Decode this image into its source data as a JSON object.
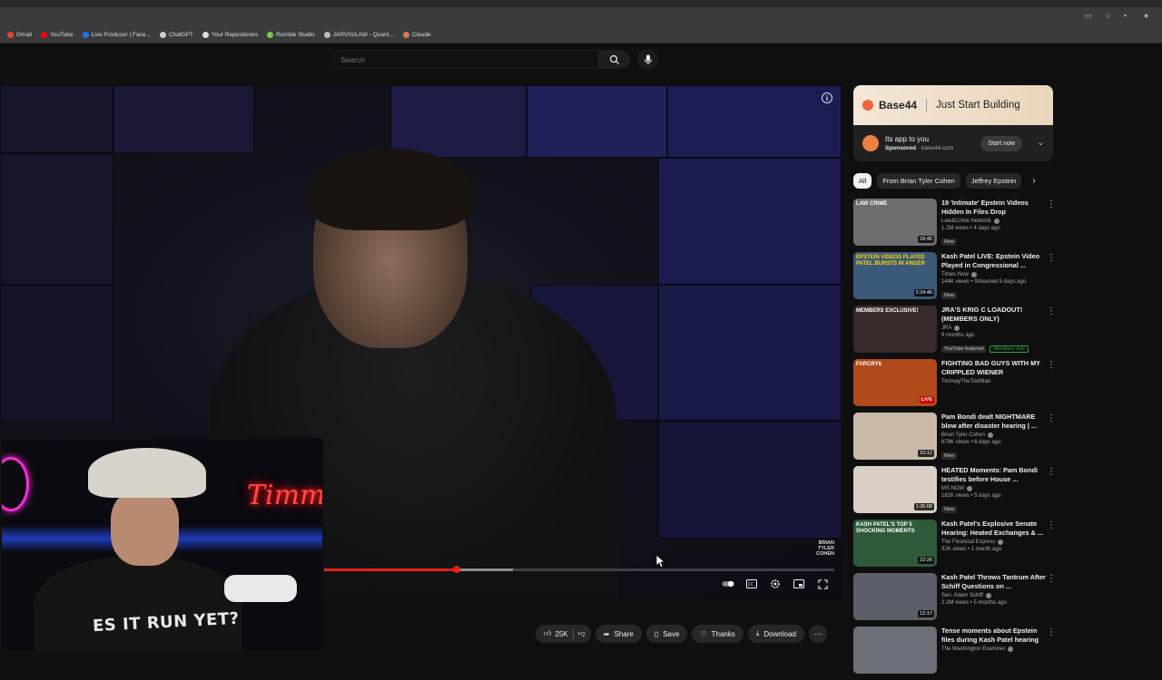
{
  "bookmarks": [
    {
      "label": "Gmail",
      "color": "#ea4335"
    },
    {
      "label": "YouTube",
      "color": "#ff0000"
    },
    {
      "label": "Live Producer | Face...",
      "color": "#1877f2"
    },
    {
      "label": "ChatGPT",
      "color": "#cccccc"
    },
    {
      "label": "Your Repositories",
      "color": "#dddddd"
    },
    {
      "label": "Rumble Studio",
      "color": "#85c742"
    },
    {
      "label": "JARVIS/LAW - Quant...",
      "color": "#bbbbbb"
    },
    {
      "label": "Claude",
      "color": "#d97757"
    }
  ],
  "search": {
    "placeholder": "Search"
  },
  "player": {
    "watermark": "BRIAN TYLER COHEN",
    "progress": 0.26,
    "buffered": 0.37
  },
  "webcam": {
    "neon_sign": "Timmay",
    "shirt_text": "ES IT RUN YET?"
  },
  "actions": {
    "likes": "25K",
    "share": "Share",
    "save": "Save",
    "thanks": "Thanks",
    "download": "Download"
  },
  "ad": {
    "brand": "Base44",
    "tagline": "Just Start Building",
    "title": "Its app to you",
    "sponsored": "Sponsored",
    "domain": "base44.com",
    "cta": "Start now"
  },
  "chips": [
    "All",
    "From Brian Tyler Cohen",
    "Jeffrey Epstein"
  ],
  "recommendations": [
    {
      "title": "19 'Intimate' Epstein Videos Hidden In Files Drop",
      "channel": "Law&Crime Network",
      "verified": true,
      "meta": "1.2M views • 4 days ago",
      "badge": "New",
      "duration": "29:45",
      "thumb_bg": "#6d6d70",
      "thumb_label": "LAW CRIME",
      "label_color": "#ffffff"
    },
    {
      "title": "Kash Patel LIVE: Epstein Video Played in Congressional ...",
      "channel": "Times Now",
      "verified": true,
      "meta": "144K views • Streamed 5 days ago",
      "badge": "New",
      "duration": "2:24:40",
      "thumb_bg": "#3b5a7a",
      "thumb_label": "EPSTEIN VIDEOS PLAYED PATEL BURSTS IN ANGER",
      "label_color": "#ffd400"
    },
    {
      "title": "JRA'S KRIG C LOADOUT! (MEMBERS ONLY)",
      "channel": "JRA",
      "verified": true,
      "meta": "9 months ago",
      "badge": "YouTube featured",
      "members": "Members only",
      "duration": "",
      "thumb_bg": "#3a2a2a",
      "thumb_label": "MEMBERS EXCLUSIVE!",
      "label_color": "#ffffff"
    },
    {
      "title": "FIGHTING BAD GUYS WITH MY CRIPPLED WIENER",
      "channel": "TimmayTheToolMan",
      "verified": false,
      "meta": "",
      "badge": "",
      "live": "LIVE",
      "duration": "",
      "thumb_bg": "#b04a1a",
      "thumb_label": "FARCRY6",
      "label_color": "#ffffff"
    },
    {
      "title": "Pam Bondi dealt NIGHTMARE blow after disaster hearing | ...",
      "channel": "Brian Tyler Cohen",
      "verified": true,
      "meta": "679K views • 6 days ago",
      "badge": "New",
      "duration": "10:12",
      "thumb_bg": "#c8b9a8",
      "thumb_label": "",
      "label_color": "#ffffff"
    },
    {
      "title": "HEATED Moments: Pam Bondi testifies before House ...",
      "channel": "MS NOW",
      "verified": true,
      "meta": "182K views • 5 days ago",
      "badge": "New",
      "duration": "1:35:08",
      "thumb_bg": "#d9cfc4",
      "thumb_label": "",
      "label_color": "#ffffff"
    },
    {
      "title": "Kash Patel's Explosive Senate Hearing: Heated Exchanges & ...",
      "channel": "The Financial Express",
      "verified": true,
      "meta": "32K views • 1 month ago",
      "badge": "",
      "duration": "22:26",
      "thumb_bg": "#2e5a3a",
      "thumb_label": "KASH PATEL'S TOP 5 SHOCKING MOMENTS",
      "label_color": "#ffffff"
    },
    {
      "title": "Kash Patel Throws Tantrum After Schiff Questions on ...",
      "channel": "Sen. Adam Schiff",
      "verified": true,
      "meta": "2.2M views • 5 months ago",
      "badge": "",
      "duration": "12:17",
      "thumb_bg": "#5a5f6a",
      "thumb_label": "",
      "label_color": "#ffffff"
    },
    {
      "title": "Tense moments about Epstein files during Kash Patel hearing",
      "channel": "The Washington Examiner",
      "verified": true,
      "meta": "",
      "badge": "",
      "duration": "",
      "thumb_bg": "#6a6f78",
      "thumb_label": "",
      "label_color": "#ffffff"
    }
  ]
}
